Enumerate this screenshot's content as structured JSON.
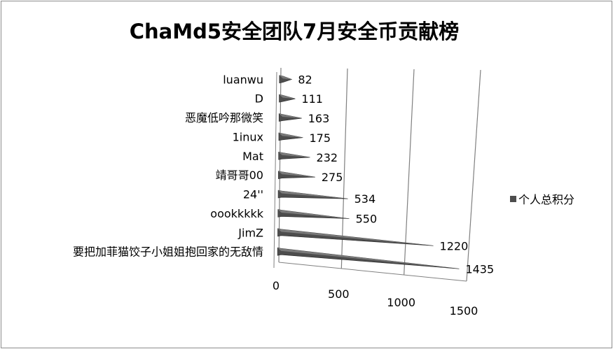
{
  "chart_data": {
    "type": "bar",
    "title": "ChaMd5安全团队7月安全币贡献榜",
    "categories": [
      "luanwu",
      "D",
      "恶魔低吟那微笑",
      "1inux",
      "Mat",
      "靖哥哥00",
      "24''",
      "oookkkkk",
      "JimZ",
      "要把加菲猫饺子小姐姐抱回家的无敌情"
    ],
    "series": [
      {
        "name": "个人总积分",
        "values": [
          82,
          111,
          163,
          175,
          232,
          275,
          534,
          550,
          1220,
          1435
        ]
      }
    ],
    "x_ticks": [
      "0",
      "500",
      "1000",
      "1500"
    ],
    "xlim": [
      0,
      1500
    ],
    "legend_position": "right",
    "bar_color": "#4d4d4d",
    "grid": true
  }
}
